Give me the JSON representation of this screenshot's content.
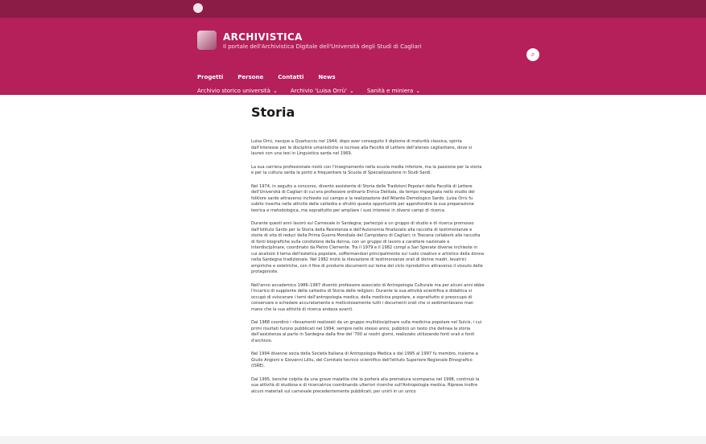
{
  "site": {
    "title": "ARCHIVISTICA",
    "subtitle": "Il portale dell'Archivistica Digitale dell'Università degli Studi di Cagliari"
  },
  "nav_main": [
    "Progetti",
    "Persone",
    "Contatti",
    "News"
  ],
  "nav_secondary": [
    "Archivio storico università",
    "Archivio 'Luisa Orrù'",
    "Sanità e miniera"
  ],
  "page": {
    "title": "Storia",
    "paragraphs": [
      "Luisa Orrù, nacque a Quartucciu nel 1944, dopo aver conseguito il diploma di maturità classica, spinta dall'interesse per le discipline umanistiche si iscrisse alla Facoltà di Lettere dell'ateneo cagliaritano, dove si laureò con una tesi in Linguistica sarda nel 1969.",
      "La sua carriera professionale iniziò con l'insegnamento nella scuola media inferiore, ma la passione per la storia e per la cultura sarda la portò a frequentare la Scuola di Specializzazione in Studi Sardi.",
      "Nel 1974, in seguito a concorso, diventò assistente di Storia delle Tradizioni Popolari della Facoltà di Lettere dell'Università di Cagliari di cui era professore ordinario Enrica Delitala, da tempo impegnata nello studio del folklore sardo attraverso inchieste sul campo e la realizzazione dell'Atlante Demologico Sardo. Luisa Orrù fu subito inserita nelle attività della cattedra e sfruttò questa opportunità per approfondire la sua preparazione teorica e metodologica, ma soprattutto per ampliare i suoi interessi in diversi campi di ricerca.",
      "Durante questi anni lavorò sul Carnevale in Sardegna; partecipò a un gruppo di studio e di ricerca promosso dall'Istituto Sardo per la Storia della Resistenza e dell'Autonomia finalizzato alla raccolta di testimonianze e storie di vita di reduci della Prima Guerra Mondiale del Campidano di Cagliari; in Toscana collaborò alla raccolta di fonti biografiche sulla condizione della donna, con un gruppo di lavoro a carattere nazionale e interdisciplinare, coordinato da Pietro Clemente. Tra il 1979 e il 1982 compì a San Sperate diverse inchieste in cui analizzò il tema dell'estetica popolare, soffermandosi principalmente sul ruolo creativo e artistico della donna nella Sardegna tradizionale. Nel 1982 iniziò la rilevazione di testimonianze orali di donne madri, levatrici empiriche e ostetriche, con il fine di produrre documenti sul tema del ciclo riproduttivo attraverso il vissuto delle protagoniste.",
      "Nell'anno accademico 1986–1987 diventò professore associato di Antropologia Culturale ma per alcuni anni ebbe l'incarico di supplente della cattedra di Storia delle religioni. Durante la sua attività scientifica e didattica si occupò di sviscerare i temi dell'antropologia medica, della medicina popolare, e soprattutto si preoccupò di conservare e schedare accuratamente e meticolosamente tutti i documenti orali che si sedimentavano man mano che la sua attività di ricerca andava avanti.",
      "Dal 1988 coordinò i rilevamenti realizzati da un gruppo multidisciplinare sulla medicina popolare nel Sulcis, i cui primi risultati furono pubblicati nel 1994; sempre nello stesso anno, pubblicò un testo che delinea la storia dell'assistenza al parto in Sardegna dalla fine del '700 ai nostri giorni, realizzato utilizzando fonti orali e fonti d'archivio.",
      "Nel 1994 divenne socia della Società Italiana di Antropologia Medica e dal 1995 al 1997 fu membro, insieme a Giulio Angioni e Giovanni Lilliu, del Comitato tecnico scientifico dell'Istituto Superiore Regionale Etnografico (ISRE).",
      "Dal 1995, benché colpita da una grave malattia che la porterà alla prematura scomparsa nel 1998, continuò la sua attività di studiosa e di ricercatrice coordinando ulteriori ricerche sull'Antropologia medica. Riprese inoltre alcuni materiali sul carnevale precedentemente pubblicati, per unirli in un unico"
    ]
  }
}
